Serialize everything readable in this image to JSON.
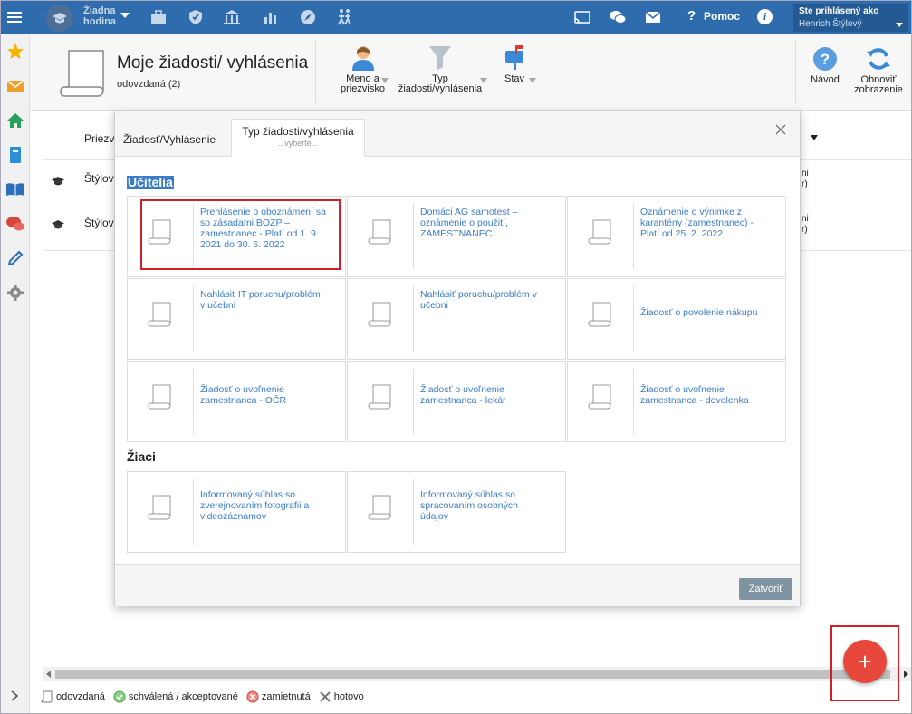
{
  "topbar": {
    "hour_label_line1": "Žiadna",
    "hour_label_line2": "hodina",
    "help_label": "Pomoc",
    "info_label": "i",
    "logged_in_label": "Ste prihlásený ako",
    "user_name": "Henrich Štýlový",
    "icons": [
      "menu-icon",
      "school-icon",
      "briefcase-icon",
      "shield-icon",
      "building-icon",
      "chart-icon",
      "compass-icon",
      "people-icon",
      "cast-icon",
      "chat-icon",
      "mail-icon",
      "help-icon",
      "info-icon"
    ]
  },
  "sidebar": {
    "icons": [
      "star-icon",
      "envelope-icon",
      "home-icon",
      "book-icon",
      "open-book-icon",
      "chat-bubbles-icon",
      "pencil-icon",
      "gear-icon"
    ]
  },
  "toolbar": {
    "title": "Moje žiadosti/ vyhlásenia",
    "subtitle": "odovzdaná (2)",
    "filter_name_line1": "Meno a",
    "filter_name_line2": "priezvisko",
    "filter_type_line1": "Typ",
    "filter_type_line2": "žiadosti/vyhlásenia",
    "filter_state": "Stav",
    "help_button": "Návod",
    "refresh_line1": "Obnoviť",
    "refresh_line2": "zobrazenie"
  },
  "table": {
    "column_header": "Priezv",
    "rows": [
      {
        "name": "Štýlový",
        "right_top": "ni",
        "right_bottom": "r)"
      },
      {
        "name": "Štýlový",
        "right_top": "ni",
        "right_bottom": "r)"
      }
    ]
  },
  "dialog": {
    "tab_type": "Žiadosť/Vyhlásenie",
    "tab_kind": "Typ žiadosti/vyhlásenia",
    "tab_kind_placeholder": "...vyberte...",
    "section_teachers": "Učitelia",
    "section_students": "Žiaci",
    "teacher_cards": [
      "Prehlásenie o oboznámení sa so zásadami BOZP – zamestnanec - Platí od 1. 9. 2021 do 30. 6. 2022",
      "Domáci AG samotest – oznámenie o použití, ZAMESTNANEC",
      "Oznámenie o výnimke z karantény (zamestnanec) - Platí od 25. 2. 2022",
      "Nahlásiť IT poruchu/problém v učebni",
      "Nahlásiť poruchu/problém v učebni",
      "Žiadosť o povolenie nákupu",
      "Žiadosť o uvoľnenie zamestnanca - OČR",
      "Žiadosť o uvoľnenie zamestnanca - lekár",
      "Žiadosť o uvoľnenie zamestnanca - dovolenka"
    ],
    "student_cards": [
      "Informovaný súhlas so zverejnovaním fotografii a videozáznamov",
      "Informovaný súhlas so spracovaním osobných údajov"
    ],
    "close_button": "Zatvoriť"
  },
  "legend": {
    "submitted": "odovzdaná",
    "approved": "schválená / akceptované",
    "rejected": "zamietnutá",
    "done": "hotovo"
  },
  "fab_label": "+",
  "colors": {
    "topbar": "#2e6cad",
    "link": "#3a7cc8",
    "highlight": "#d21e2b",
    "fab": "#e8483c"
  }
}
